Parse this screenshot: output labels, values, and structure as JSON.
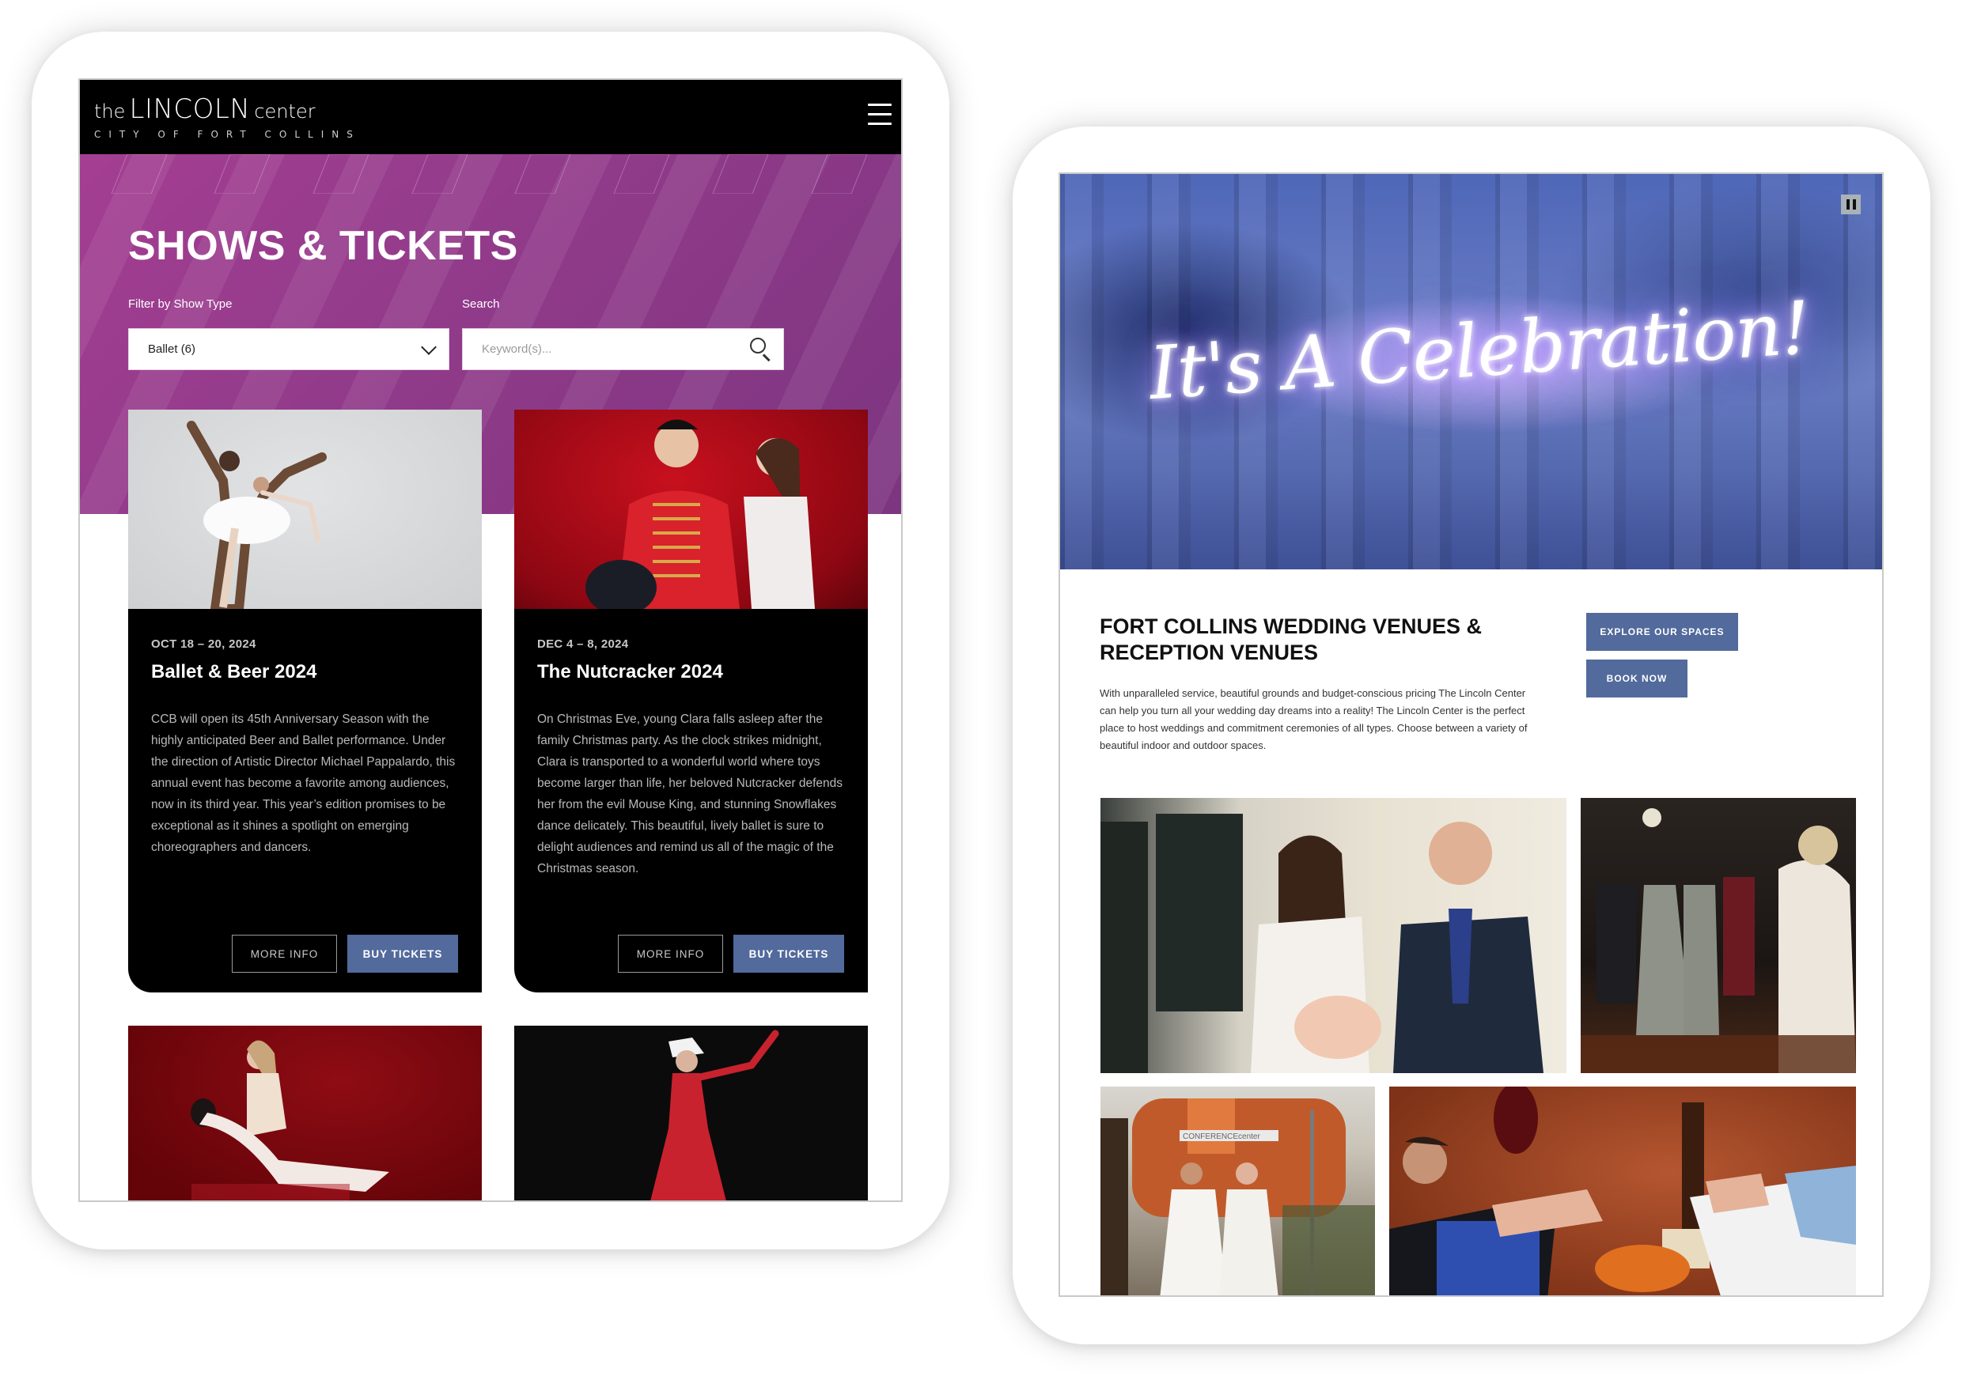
{
  "left_tablet": {
    "logo": {
      "prefix": "the",
      "name": "LINCOLN",
      "suffix": "center",
      "subtitle": "CITY OF FORT COLLINS"
    },
    "menu_icon": "hamburger-icon",
    "page_title": "SHOWS & TICKETS",
    "filter": {
      "label": "Filter by Show Type",
      "selected": "Ballet (6)"
    },
    "search": {
      "label": "Search",
      "value": "",
      "placeholder": "Keyword(s)..."
    },
    "shows": [
      {
        "date": "OCT 18 – 20, 2024",
        "title": "Ballet & Beer 2024",
        "description": "CCB will open its 45th Anniversary Season with the highly anticipated Beer and Ballet performance. Under the direction of Artistic Director Michael Pappalardo, this annual event has become a favorite among audiences, now in its third year. This year’s edition promises to be exceptional as it shines a spotlight on emerging choreographers and dancers.",
        "more_info_label": "MORE INFO",
        "buy_label": "BUY TICKETS"
      },
      {
        "date": "DEC 4 – 8, 2024",
        "title": "The Nutcracker 2024",
        "description": "On Christmas Eve, young Clara falls asleep after the family Christmas party. As the clock strikes midnight, Clara is transported to a wonderful world where toys become larger than life, her beloved Nutcracker defends her from the evil Mouse King, and stunning Snowflakes dance delicately. This beautiful, lively ballet is sure to delight audiences and remind us all of the magic of the Christmas season.",
        "more_info_label": "MORE INFO",
        "buy_label": "BUY TICKETS"
      }
    ]
  },
  "right_tablet": {
    "hero_text": "It's A Celebration!",
    "pause_icon": "pause-icon",
    "heading": "FORT COLLINS WEDDING VENUES & RECEPTION VENUES",
    "body": "With unparalleled service, beautiful grounds and budget-conscious pricing The Lincoln Center can help you turn all your wedding day dreams into a reality! The Lincoln Center is the perfect place to host weddings and commitment ceremonies of all types. Choose between a variety of beautiful indoor and outdoor spaces.",
    "explore_label": "EXPLORE OUR SPACES",
    "book_label": "BOOK NOW",
    "sign_text": "CONFERENCEcenter"
  },
  "colors": {
    "brand_purple": "#933b8b",
    "button_blue": "#526a9c",
    "header_black": "#000000"
  }
}
